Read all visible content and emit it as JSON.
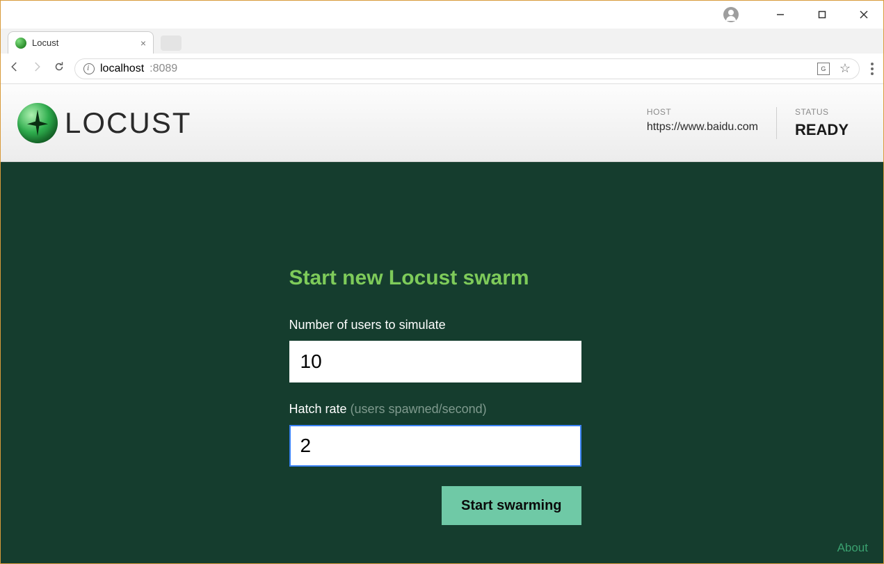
{
  "window": {
    "tab_title": "Locust",
    "url_host": "localhost",
    "url_port": ":8089"
  },
  "app_header": {
    "brand": "LOCUST",
    "host_label": "HOST",
    "host_value": "https://www.baidu.com",
    "status_label": "STATUS",
    "status_value": "READY"
  },
  "form": {
    "title": "Start new Locust swarm",
    "users_label": "Number of users to simulate",
    "users_value": "10",
    "hatch_label": "Hatch rate ",
    "hatch_hint": "(users spawned/second)",
    "hatch_value": "2",
    "submit_label": "Start swarming"
  },
  "footer": {
    "about": "About"
  }
}
